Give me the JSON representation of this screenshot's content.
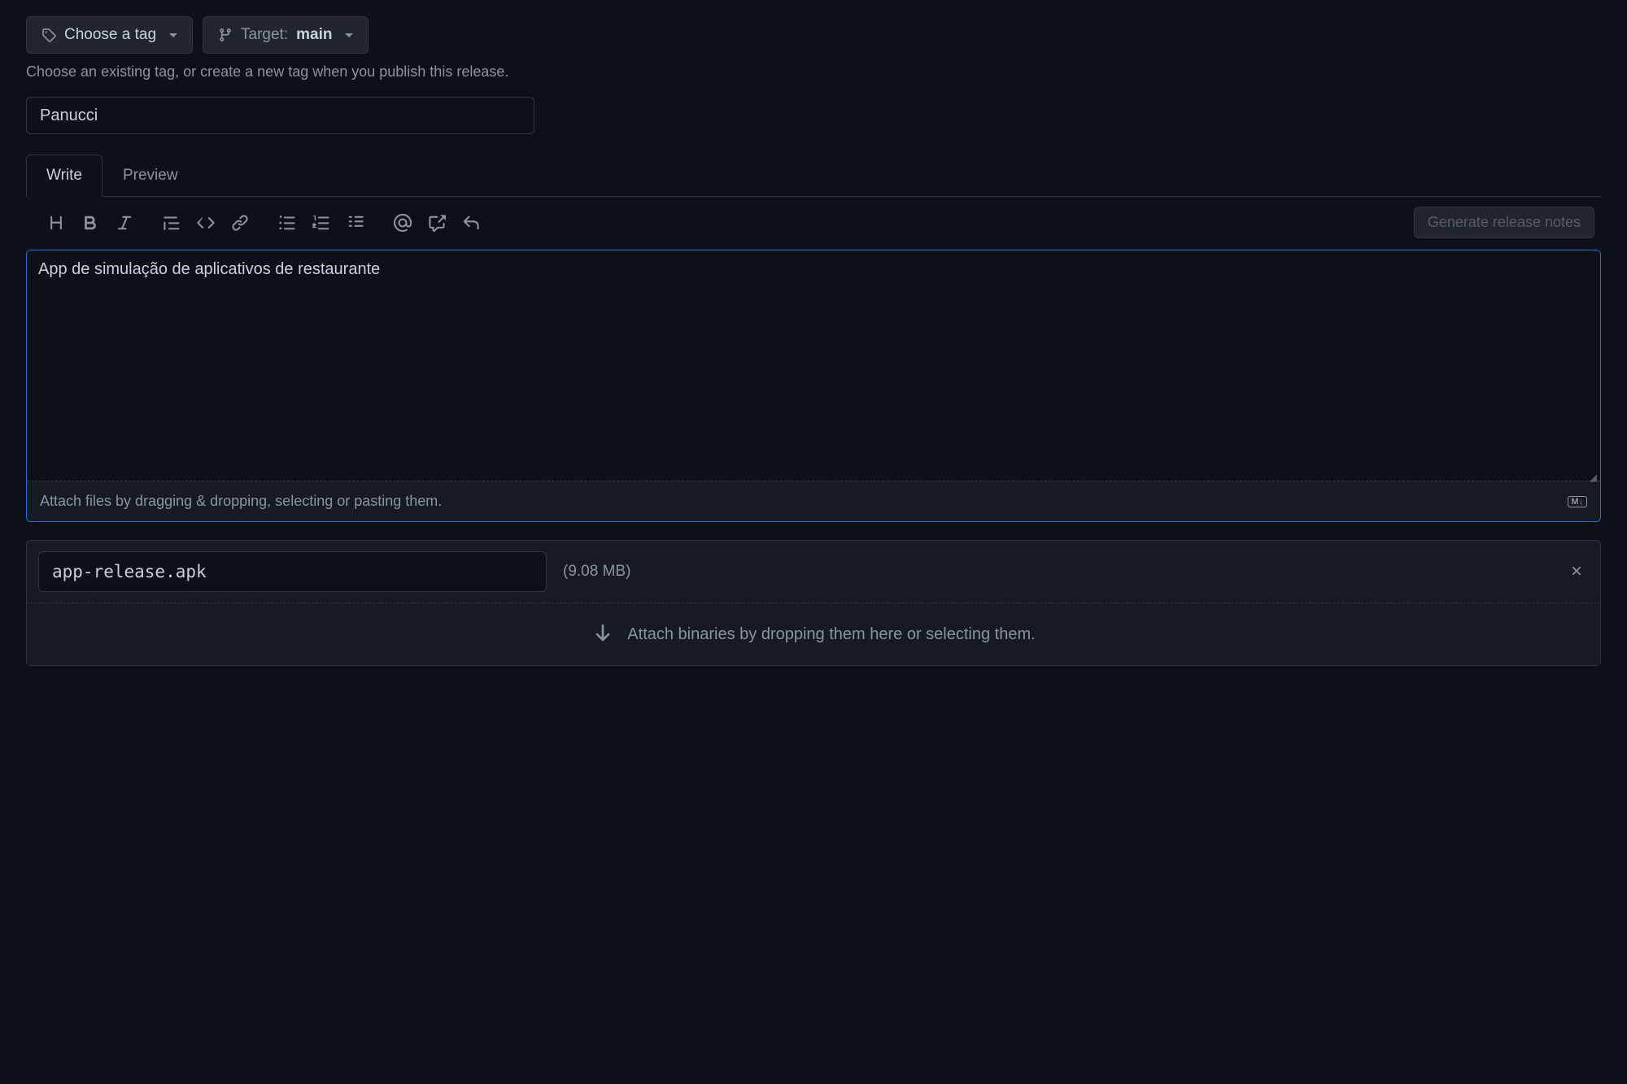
{
  "tagSelector": {
    "label": "Choose a tag"
  },
  "targetSelector": {
    "prefix": "Target:",
    "branch": "main"
  },
  "tagHelper": "Choose an existing tag, or create a new tag when you publish this release.",
  "titleField": {
    "value": "Panucci"
  },
  "tabs": {
    "write": "Write",
    "preview": "Preview"
  },
  "generateNotes": "Generate release notes",
  "description": {
    "value": "App de simulação de aplicativos de restaurante"
  },
  "attachHint": "Attach files by dragging & dropping, selecting or pasting them.",
  "mdBadge": "M↓",
  "binaries": [
    {
      "filename": "app-release.apk",
      "size": "(9.08 MB)"
    }
  ],
  "dropzoneText": "Attach binaries by dropping them here or selecting them."
}
